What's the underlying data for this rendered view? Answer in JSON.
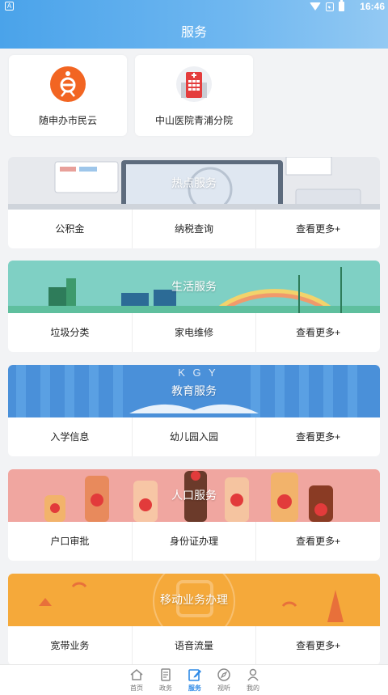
{
  "status_bar": {
    "time": "16:46",
    "left_badge": "A"
  },
  "page": {
    "title": "服务"
  },
  "quick_services": [
    {
      "label": "随申办市民云",
      "icon": "suishenban-logo"
    },
    {
      "label": "中山医院青浦分院",
      "icon": "hospital-logo"
    }
  ],
  "sections": [
    {
      "title": "热点服务",
      "items": [
        "公积金",
        "纳税查询",
        "查看更多+"
      ]
    },
    {
      "title": "生活服务",
      "items": [
        "垃圾分类",
        "家电维修",
        "查看更多+"
      ]
    },
    {
      "title": "教育服务",
      "items": [
        "入学信息",
        "幼儿园入园",
        "查看更多+"
      ]
    },
    {
      "title": "人口服务",
      "items": [
        "户口审批",
        "身份证办理",
        "查看更多+"
      ]
    },
    {
      "title": "移动业务办理",
      "items": [
        "宽带业务",
        "语音流量",
        "查看更多+"
      ]
    }
  ],
  "edu_banner_letters": "K G Y",
  "bottom_nav": [
    {
      "label": "首页",
      "icon": "home-icon"
    },
    {
      "label": "政务",
      "icon": "document-icon"
    },
    {
      "label": "服务",
      "icon": "edit-icon",
      "active": true
    },
    {
      "label": "视听",
      "icon": "compass-icon"
    },
    {
      "label": "我的",
      "icon": "user-icon"
    }
  ],
  "colors": {
    "header": "#4aa3ea",
    "nav_active": "#2f8ae6",
    "logo_orange": "#f26522",
    "hospital_red": "#e43d3d"
  }
}
